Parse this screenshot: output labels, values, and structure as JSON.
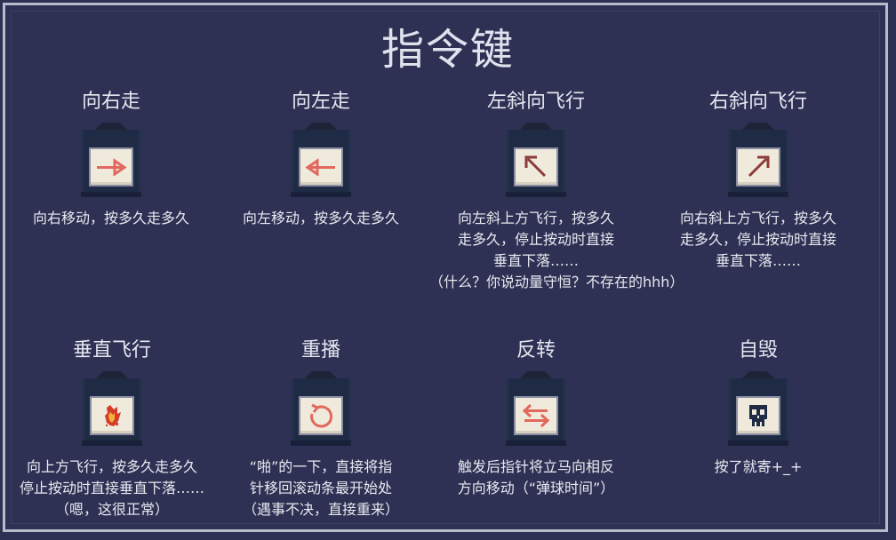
{
  "title": "指令键",
  "commands": [
    {
      "name": "向右走",
      "icon": "right-arrow-icon",
      "desc": [
        "向右移动，按多久走多久"
      ]
    },
    {
      "name": "向左走",
      "icon": "left-arrow-icon",
      "desc": [
        "向左移动，按多久走多久"
      ]
    },
    {
      "name": "左斜向飞行",
      "icon": "up-left-arrow-icon",
      "desc": [
        "向左斜上方飞行，按多久",
        "走多久，停止按动时直接",
        "垂直下落……",
        "（什么？你说动量守恒？不存在的hhh）"
      ]
    },
    {
      "name": "右斜向飞行",
      "icon": "up-right-arrow-icon",
      "desc": [
        "向右斜上方飞行，按多久",
        "走多久，停止按动时直接",
        "垂直下落……"
      ]
    },
    {
      "name": "垂直飞行",
      "icon": "fire-icon",
      "desc": [
        "向上方飞行，按多久走多久",
        "停止按动时直接垂直下落……",
        "（嗯，这很正常）"
      ]
    },
    {
      "name": "重播",
      "icon": "replay-icon",
      "desc": [
        "“啪”的一下，直接将指",
        "针移回滚动条最开始处",
        "（遇事不决，直接重来）"
      ]
    },
    {
      "name": "反转",
      "icon": "reverse-icon",
      "desc": [
        "触发后指针将立马向相反",
        "方向移动（“弹球时间”）"
      ]
    },
    {
      "name": "自毁",
      "icon": "skull-icon",
      "desc": [
        "按了就寄+_+"
      ]
    }
  ],
  "colors": {
    "background": "#2e3153",
    "frame": "#b7bccb",
    "card": "#1f2a44",
    "card_face": "#efeadb",
    "arrow": "#e2685e",
    "skull": "#1f2a44"
  }
}
